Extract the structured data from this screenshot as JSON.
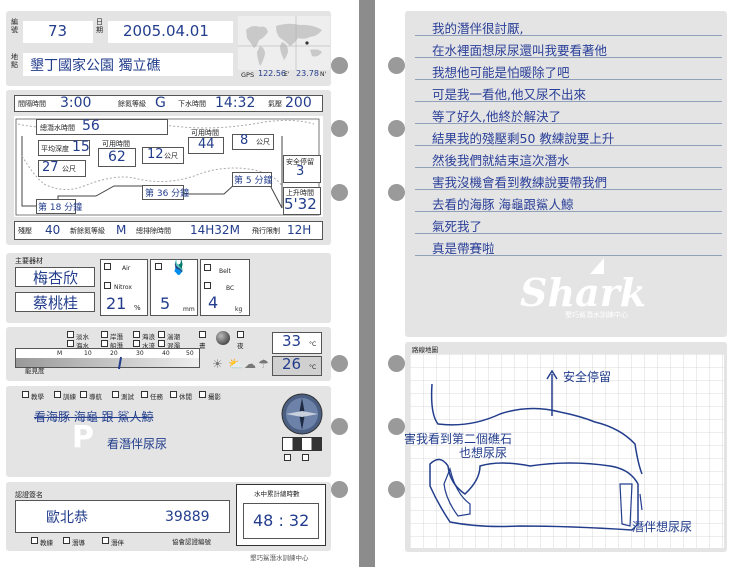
{
  "header": {
    "no_label": "編號",
    "no_value": "73",
    "date_label": "日期",
    "date_value": "2005.04.01",
    "place_label": "地點",
    "place_value": "墾丁國家公園 獨立礁",
    "gps_label": "GPS",
    "gps_lon": "122.56",
    "gps_e": "E'",
    "gps_lat": "23.78",
    "gps_n": "N'"
  },
  "dive": {
    "surface_interval_label": "間隔時間",
    "surface_interval": "3:00",
    "residual_group_label": "餘氮等級",
    "residual_group": "G",
    "dive_time_label": "下水時間",
    "dive_time": "14:32",
    "tank_pressure_label": "氣壓",
    "tank_pressure": "200",
    "bottom_time_label": "總潛水時間",
    "bottom_time": "56",
    "avg_depth_label": "平均深度",
    "avg_depth": "15",
    "max_time_label_1": "可用時間",
    "max_time_1": "62",
    "depth_1": "12",
    "depth_1_unit": "公尺",
    "max_time_label_2": "可用時間",
    "max_time_2": "44",
    "depth_2": "8",
    "depth_2_unit": "公尺",
    "max_depth": "27",
    "max_depth_unit": "公尺",
    "stage_1": "第 36 分鐘",
    "stage_2": "第 18 分鐘",
    "stage_3": "第 5 分鐘",
    "stage_unit": "分鐘",
    "stage_prefix": "第",
    "safety_stop_label": "安全停留",
    "safety_stop": "3",
    "exit_time_label": "上升時間",
    "exit_time": "5'32",
    "end_group_label": "殘壓",
    "end_group": "40",
    "new_group_label": "新餘氮等級",
    "new_group": "M",
    "total_time_label": "總排除時間",
    "total_time": "14H32M",
    "no_fly_label": "飛行限制",
    "no_fly": "12H"
  },
  "equipment": {
    "title": "主要器材",
    "item_1": "梅杏欣",
    "item_2": "蔡桃桂",
    "air_label": "Air",
    "nitrox_label": "Nitrox",
    "mix_value": "21",
    "mix_unit": "%",
    "suit_value": "5",
    "suit_unit": "mm",
    "belt_label": "Belt",
    "bc_label": "BC",
    "weight_value": "4",
    "weight_unit": "kg"
  },
  "conditions": {
    "fresh": "淡水",
    "shore": "岸潛",
    "wave": "海浪",
    "current": "湍潮",
    "sea": "海水",
    "boat": "船潛",
    "flow": "水流",
    "clear": "混濁",
    "day": "晝",
    "night": "夜",
    "visibility_label": "能見度",
    "scale_m": "M",
    "scale_10": "10",
    "scale_20": "20",
    "scale_30": "30",
    "scale_40": "40",
    "scale_50": "50",
    "air_temp": "33",
    "water_temp": "26",
    "temp_unit": "°C"
  },
  "purpose": {
    "teach": "教學",
    "train": "訓練",
    "guide": "導航",
    "test": "測試",
    "mission": "任務",
    "rest": "休閒",
    "photo": "攝影",
    "note_struck": "看海豚 海龜 跟 鯊人鯨",
    "note": "看潛伴尿尿"
  },
  "signature": {
    "title": "認證簽名",
    "name": "歐北恭",
    "number": "39889",
    "cert_label": "協會認證編號",
    "instructor": "教練",
    "divemaster": "潛導",
    "buddy": "潛伴",
    "cumulative_label": "水中累計總時數",
    "cumulative": "48 : 32",
    "footer": "墾巧鯊潛水訓練中心"
  },
  "notes": {
    "lines": [
      "我的潛伴很討厭,",
      "在水裡面想尿尿還叫我要看著他",
      "我想他可能是怕暖除了吧",
      "可是我一看他,他又尿不出來",
      "等了好久,他終於解決了",
      "結果我的殘壓剩50 教練說要上升",
      "然後我們就結束這次潛水",
      "害我沒機會看到教練說要帶我們",
      "去看的海豚 海龜跟鯊人鯨",
      "氣死我了",
      "真是帶賽啦"
    ]
  },
  "brand": {
    "name": "Shark",
    "sub": "墾巧鯊潛水訓練中心"
  },
  "map": {
    "title": "路線地圖",
    "safety_stop": "安全停留",
    "note_1": "害我看到第二個礁石",
    "note_2": "也想尿尿",
    "note_3": "潛伴想尿尿"
  }
}
